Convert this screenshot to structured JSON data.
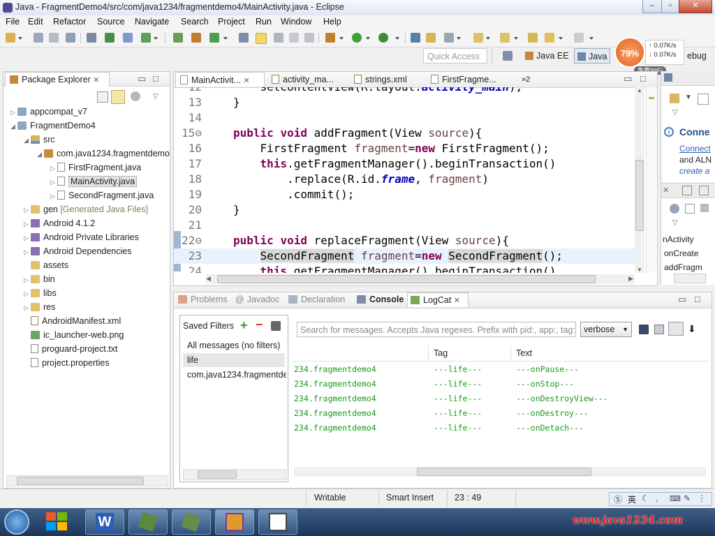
{
  "window": {
    "title": "Java - FragmentDemo4/src/com/java1234/fragmentdemo4/MainActivity.java - Eclipse"
  },
  "menu": [
    "File",
    "Edit",
    "Refactor",
    "Source",
    "Navigate",
    "Search",
    "Project",
    "Run",
    "Window",
    "Help"
  ],
  "quick_access": "Quick Access",
  "perspectives": {
    "java_ee": "Java EE",
    "java": "Java",
    "debug": "ebug"
  },
  "speed": {
    "percent": "79%",
    "up": "0.07K/s",
    "down": "0.07K/s",
    "wifi": "免费WiFi"
  },
  "package_explorer": {
    "title": "Package Explorer",
    "tree": [
      {
        "label": "appcompat_v7",
        "indent": 0,
        "twist": "▷",
        "icon": "ic-proj"
      },
      {
        "label": "FragmentDemo4",
        "indent": 0,
        "twist": "◢",
        "icon": "ic-proj"
      },
      {
        "label": "src",
        "indent": 1,
        "twist": "◢",
        "icon": "ic-src"
      },
      {
        "label": "com.java1234.fragmentdemo4",
        "indent": 2,
        "twist": "◢",
        "icon": "ic-pkgi"
      },
      {
        "label": "FirstFragment.java",
        "indent": 3,
        "twist": "▷",
        "icon": "ic-file"
      },
      {
        "label": "MainActivity.java",
        "indent": 3,
        "twist": "▷",
        "icon": "ic-file",
        "selected": true
      },
      {
        "label": "SecondFragment.java",
        "indent": 3,
        "twist": "▷",
        "icon": "ic-file"
      },
      {
        "label": "gen",
        "suffix": " [Generated Java Files]",
        "indent": 1,
        "twist": "▷",
        "icon": "ic-folder"
      },
      {
        "label": "Android 4.1.2",
        "indent": 1,
        "twist": "▷",
        "icon": "ic-lib"
      },
      {
        "label": "Android Private Libraries",
        "indent": 1,
        "twist": "▷",
        "icon": "ic-lib"
      },
      {
        "label": "Android Dependencies",
        "indent": 1,
        "twist": "▷",
        "icon": "ic-lib"
      },
      {
        "label": "assets",
        "indent": 1,
        "twist": "",
        "icon": "ic-folder"
      },
      {
        "label": "bin",
        "indent": 1,
        "twist": "▷",
        "icon": "ic-folder"
      },
      {
        "label": "libs",
        "indent": 1,
        "twist": "▷",
        "icon": "ic-folder"
      },
      {
        "label": "res",
        "indent": 1,
        "twist": "▷",
        "icon": "ic-folder"
      },
      {
        "label": "AndroidManifest.xml",
        "indent": 1,
        "twist": "",
        "icon": "ic-xml"
      },
      {
        "label": "ic_launcher-web.png",
        "indent": 1,
        "twist": "",
        "icon": "ic-img"
      },
      {
        "label": "proguard-project.txt",
        "indent": 1,
        "twist": "",
        "icon": "ic-txt"
      },
      {
        "label": "project.properties",
        "indent": 1,
        "twist": "",
        "icon": "ic-txt"
      }
    ]
  },
  "editor": {
    "tabs": [
      "MainActivit...",
      "activity_ma...",
      "strings.xml",
      "FirstFragme..."
    ],
    "overflow": "»2",
    "lines": [
      {
        "n": "12",
        "html": "    setContentView(R.layout.<span class='fld'>activity_main</span>);"
      },
      {
        "n": "13",
        "html": "}"
      },
      {
        "n": "14",
        "html": ""
      },
      {
        "n": "15⊖",
        "html": "<span class='kw'>public</span> <span class='kw'>void</span> addFragment(View <span class='var'>source</span>){"
      },
      {
        "n": "16",
        "html": "    FirstFragment <span class='var'>fragment</span>=<span class='kw'>new</span> FirstFragment();"
      },
      {
        "n": "17",
        "html": "    <span class='kw'>this</span>.getFragmentManager().beginTransaction()"
      },
      {
        "n": "18",
        "html": "        .replace(R.id.<span class='fld'>frame</span>, <span class='var'>fragment</span>)"
      },
      {
        "n": "19",
        "html": "        .commit();"
      },
      {
        "n": "20",
        "html": "}"
      },
      {
        "n": "21",
        "html": ""
      },
      {
        "n": "22⊖",
        "html": "<span class='kw'>public</span> <span class='kw'>void</span> replaceFragment(View <span class='var'>source</span>){"
      },
      {
        "n": "23",
        "html": "    <span class='mk'>SecondFragment</span> <span class='var'>fragment</span>=<span class='kw'>new</span> <span class='mk'>SecondFragment</span>();",
        "current": true
      },
      {
        "n": "24",
        "html": "    <span class='kw'>this</span>.getFragmentManager().beginTransaction()"
      }
    ]
  },
  "right_panel": {
    "connect": "Conne",
    "connect_link": "Connect",
    "and_text": "and ALN",
    "create": "create a",
    "outline": [
      "nActivity",
      "onCreate",
      "addFragm"
    ]
  },
  "bottom": {
    "tabs": [
      "Problems",
      "Javadoc",
      "Declaration",
      "Console",
      "LogCat"
    ],
    "saved_filters": "Saved Filters",
    "filters": [
      "All messages (no filters)",
      "life",
      "com.java1234.fragmentdemo4"
    ],
    "search_placeholder": "Search for messages. Accepts Java regexes. Prefix with pid:, app:, tag: or text: to limit scope.",
    "level": "verbose",
    "columns": {
      "tag": "Tag",
      "text": "Text"
    },
    "rows": [
      {
        "app": "234.fragmentdemo4",
        "tag": "---life---",
        "text": "---onPause---"
      },
      {
        "app": "234.fragmentdemo4",
        "tag": "---life---",
        "text": "---onStop---"
      },
      {
        "app": "234.fragmentdemo4",
        "tag": "---life---",
        "text": "---onDestroyView---"
      },
      {
        "app": "234.fragmentdemo4",
        "tag": "---life---",
        "text": "---onDestroy---"
      },
      {
        "app": "234.fragmentdemo4",
        "tag": "---life---",
        "text": "---onDetach---"
      }
    ]
  },
  "status": {
    "writable": "Writable",
    "insert": "Smart Insert",
    "position": "23 : 49"
  },
  "tray": {
    "ime": "英",
    "watermark": "www.java1234.com"
  }
}
